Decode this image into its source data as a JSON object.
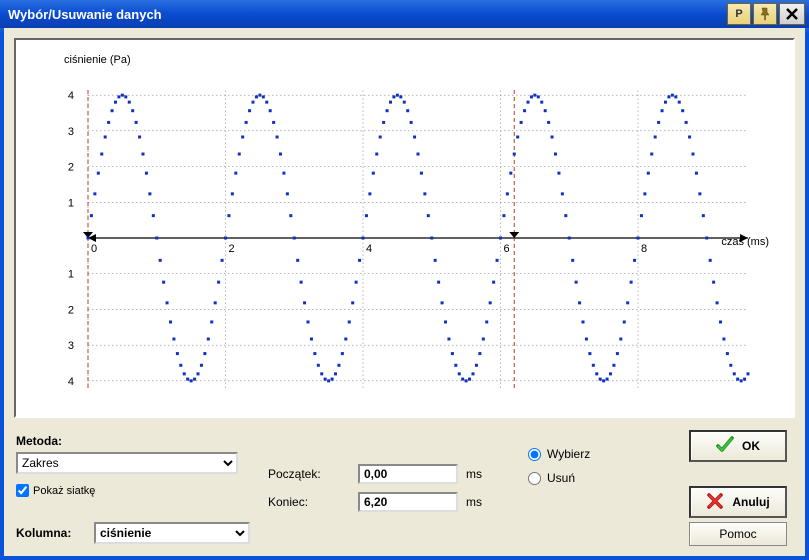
{
  "window": {
    "title": "Wybór/Usuwanie danych"
  },
  "titlebar_buttons": {
    "p": "P",
    "pin": "📌",
    "close": "✕"
  },
  "chart": {
    "ylabel": "ciśnienie (Pa)",
    "xlabel": "czas (ms)"
  },
  "chart_data": {
    "type": "scatter",
    "title": "",
    "xlabel": "czas (ms)",
    "ylabel": "ciśnienie (Pa)",
    "xlim": [
      0,
      9.6
    ],
    "ylim": [
      -4.2,
      4.2
    ],
    "xticks": [
      0,
      2,
      4,
      6,
      8
    ],
    "yticks": [
      -4,
      -3,
      -2,
      -1,
      1,
      2,
      3,
      4
    ],
    "selection_range": [
      0.0,
      6.2
    ],
    "grid": true,
    "series": [
      {
        "name": "ciśnienie",
        "function": "4*sin(2*pi*x/2)",
        "x_start": 0.0,
        "x_step": 0.05,
        "x_end": 9.6
      }
    ]
  },
  "controls": {
    "metoda_label": "Metoda:",
    "metoda_value": "Zakres",
    "metoda_options": [
      "Zakres"
    ],
    "show_grid_label": "Pokaż siatkę",
    "show_grid_checked": true,
    "poczatek_label": "Początek:",
    "poczatek_value": "0,00",
    "koniec_label": "Koniec:",
    "koniec_value": "6,20",
    "unit": "ms",
    "radio_wybierz": "Wybierz",
    "radio_usun": "Usuń",
    "radio_selected": "wybierz",
    "kolumna_label": "Kolumna:",
    "kolumna_value": "ciśnienie",
    "kolumna_options": [
      "ciśnienie"
    ]
  },
  "buttons": {
    "ok": "OK",
    "anuluj": "Anuluj",
    "pomoc": "Pomoc"
  }
}
